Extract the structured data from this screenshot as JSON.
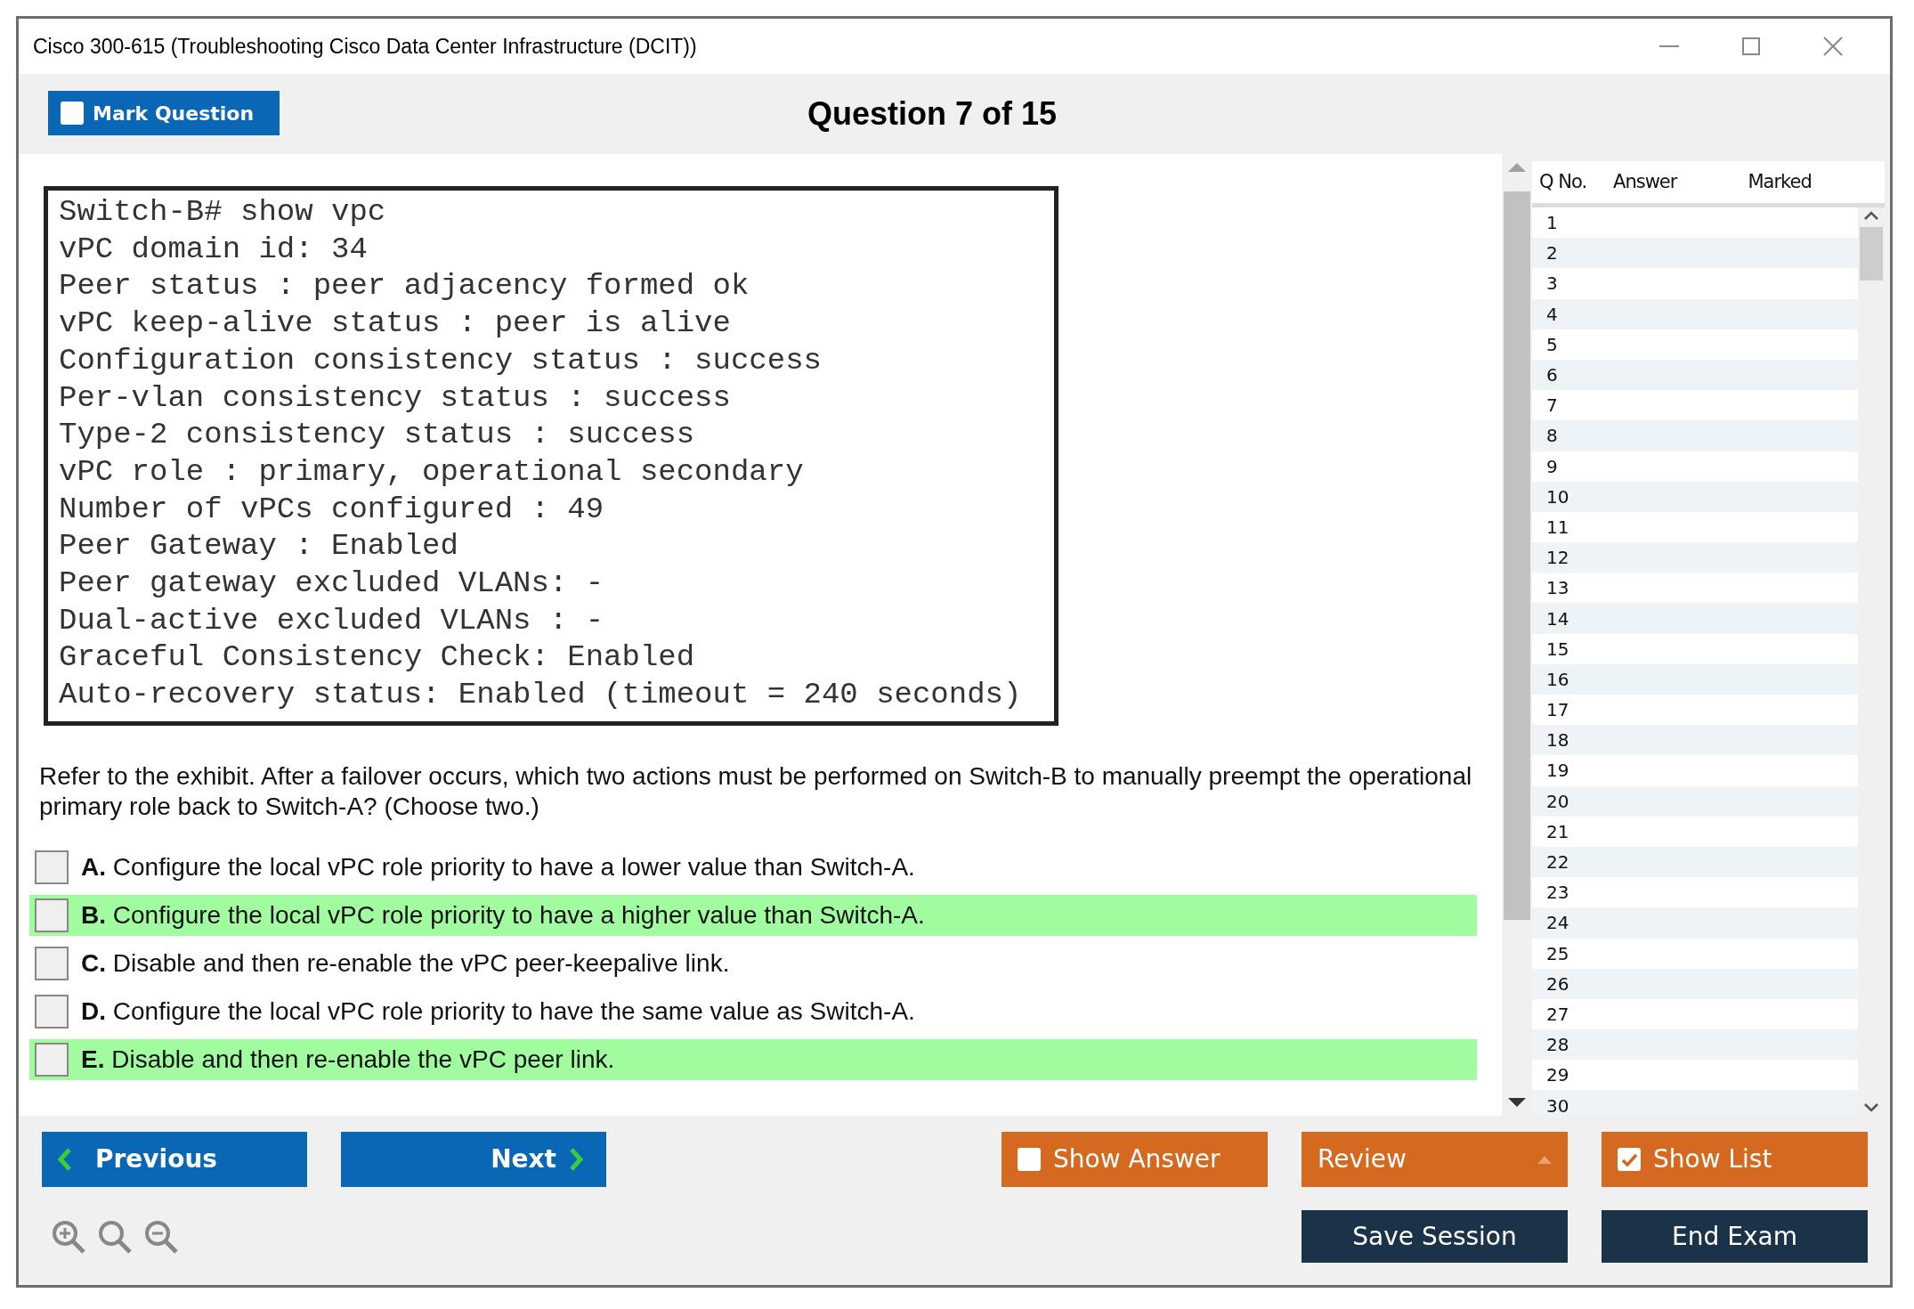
{
  "window": {
    "title": "Cisco 300-615 (Troubleshooting Cisco Data Center Infrastructure (DCIT))"
  },
  "mark_question": {
    "label": "Mark Question",
    "checked": false
  },
  "question_header": "Question 7 of 15",
  "exhibit": {
    "lines": [
      "Switch-B# show vpc",
      "vPC domain id: 34",
      "Peer status : peer adjacency formed ok",
      "vPC keep-alive status : peer is alive",
      "Configuration consistency status : success",
      "Per-vlan consistency status : success",
      "Type-2 consistency status : success",
      "vPC role : primary, operational secondary",
      "Number of vPCs configured : 49",
      "Peer Gateway : Enabled",
      "Peer gateway excluded VLANs: -",
      "Dual-active excluded VLANs : -",
      "Graceful Consistency Check: Enabled",
      "Auto-recovery status: Enabled (timeout = 240 seconds)"
    ]
  },
  "question_text": "Refer to the exhibit. After a failover occurs, which two actions must be performed on Switch-B to manually preempt the operational primary role back to Switch-A? (Choose two.)",
  "options": [
    {
      "letter": "A.",
      "text": "Configure the local vPC role priority to have a lower value than Switch-A.",
      "checked": false,
      "highlighted": false
    },
    {
      "letter": "B.",
      "text": "Configure the local vPC role priority to have a higher value than Switch-A.",
      "checked": false,
      "highlighted": true
    },
    {
      "letter": "C.",
      "text": "Disable and then re-enable the vPC peer-keepalive link.",
      "checked": false,
      "highlighted": false
    },
    {
      "letter": "D.",
      "text": "Configure the local vPC role priority to have the same value as Switch-A.",
      "checked": false,
      "highlighted": false
    },
    {
      "letter": "E.",
      "text": "Disable and then re-enable the vPC peer link.",
      "checked": false,
      "highlighted": true
    }
  ],
  "question_list": {
    "columns": [
      "Q No.",
      "Answer",
      "Marked"
    ],
    "rows": [
      "1",
      "2",
      "3",
      "4",
      "5",
      "6",
      "7",
      "8",
      "9",
      "10",
      "11",
      "12",
      "13",
      "14",
      "15",
      "16",
      "17",
      "18",
      "19",
      "20",
      "21",
      "22",
      "23",
      "24",
      "25",
      "26",
      "27",
      "28",
      "29",
      "30"
    ]
  },
  "buttons": [
    {
      "kind": "prev",
      "label": "Previous"
    },
    {
      "kind": "next",
      "label": "Next"
    },
    {
      "kind": "check",
      "label": "Show Answer",
      "checked": false
    },
    {
      "kind": "dropdown",
      "label": "Review"
    },
    {
      "kind": "check",
      "label": "Show List",
      "checked": true
    },
    {
      "kind": "dark",
      "label": "Save Session"
    },
    {
      "kind": "dark",
      "label": "End Exam"
    }
  ]
}
